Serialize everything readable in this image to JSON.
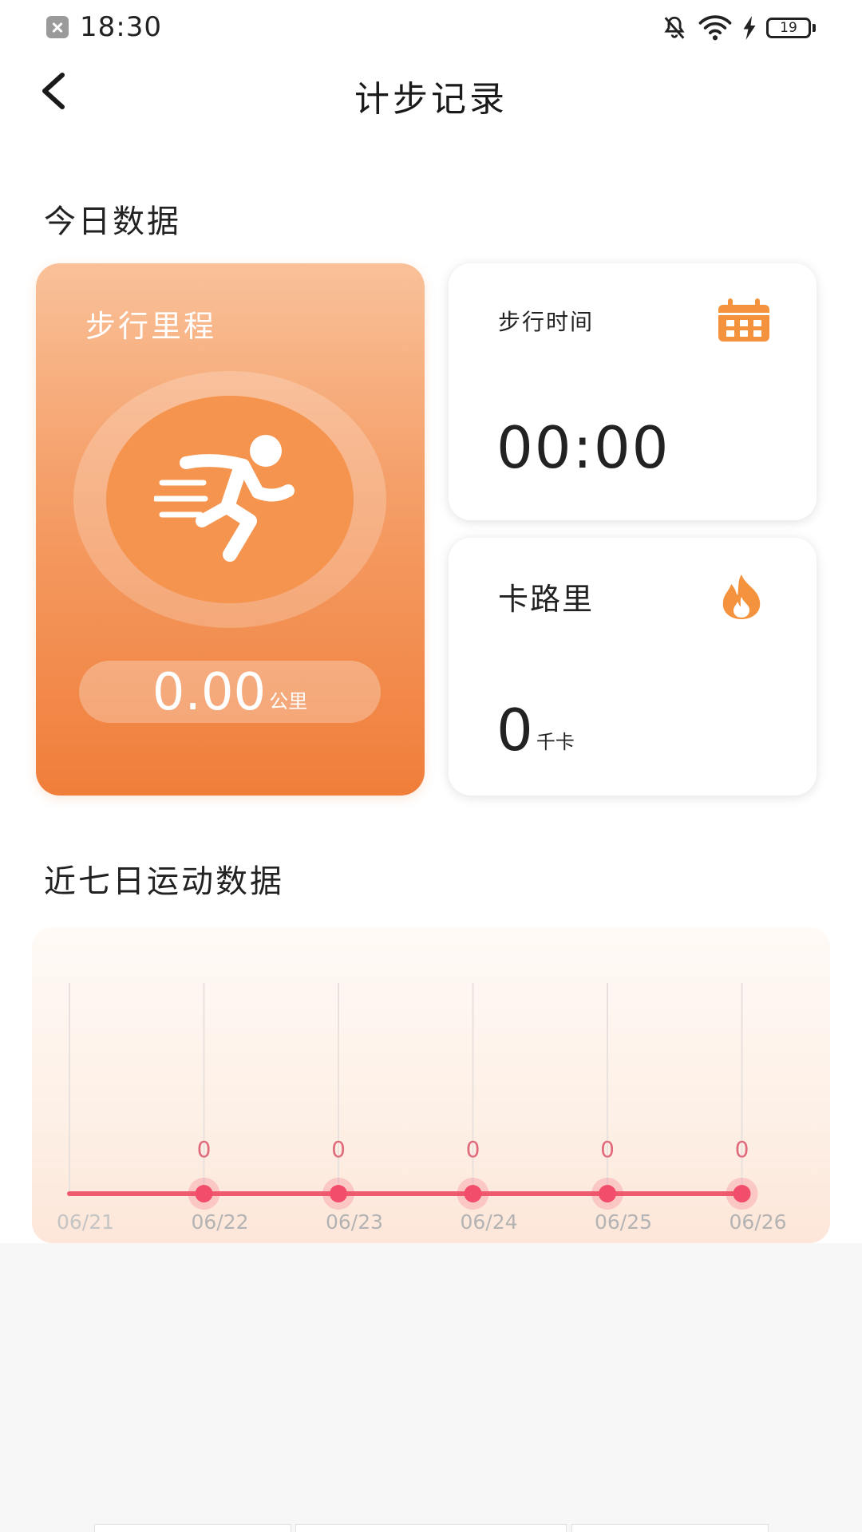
{
  "status_bar": {
    "time": "18:30",
    "battery": "19",
    "icons": [
      "notification-dismissed-icon",
      "bell-off-icon",
      "wifi-icon",
      "charging-bolt-icon",
      "battery-icon"
    ]
  },
  "header": {
    "title": "计步记录",
    "back_icon": "chevron-left-icon"
  },
  "today": {
    "section_title": "今日数据",
    "mileage": {
      "label": "步行里程",
      "value": "0.00",
      "unit": "公里",
      "icon": "running-person-icon"
    },
    "walk_time": {
      "label": "步行时间",
      "value": "00:00",
      "icon": "calendar-icon"
    },
    "calories": {
      "label": "卡路里",
      "value": "0",
      "unit": "千卡",
      "icon": "flame-icon"
    }
  },
  "week": {
    "section_title": "近七日运动数据"
  },
  "colors": {
    "accent": "#F07E3A",
    "line": "#EF5B6E",
    "point": "#F24E6B"
  },
  "chart_data": {
    "type": "line",
    "categories": [
      "06/21",
      "06/22",
      "06/23",
      "06/24",
      "06/25",
      "06/26"
    ],
    "values": [
      0,
      0,
      0,
      0,
      0,
      0
    ],
    "data_labels": [
      "",
      "0",
      "0",
      "0",
      "0",
      "0"
    ],
    "grid": true
  }
}
